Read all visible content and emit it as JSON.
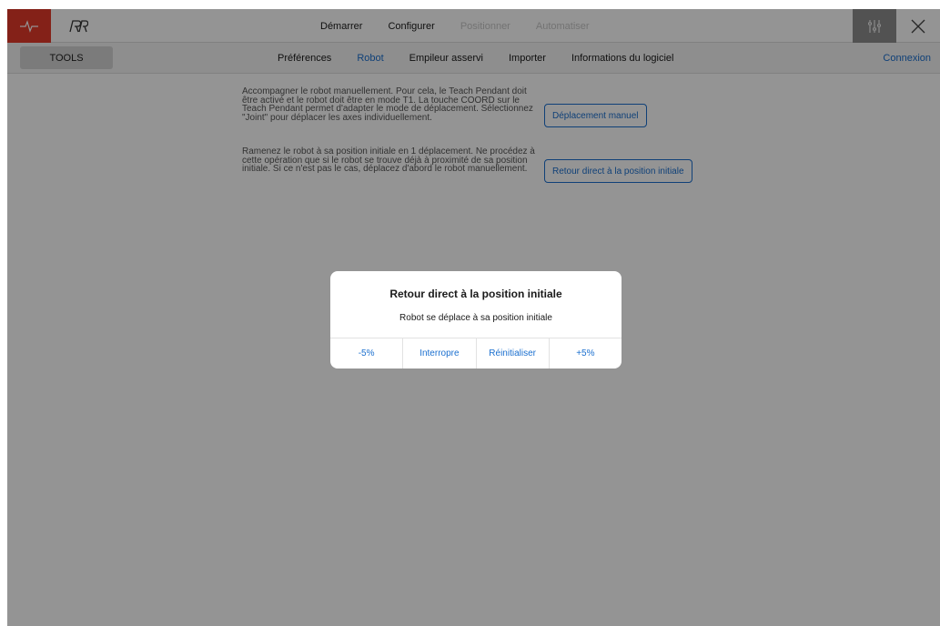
{
  "colors": {
    "accent": "#1a6fcf",
    "brand_red": "#e3392a",
    "overlay": "rgba(0,0,0,0.42)"
  },
  "topbar": {
    "pulse_icon": "pulse-icon",
    "logo_icon": "robot-logo-icon",
    "nav": [
      "Démarrer",
      "Configurer",
      "Positionner",
      "Automatiser"
    ],
    "disabled": [
      "Positionner",
      "Automatiser"
    ],
    "settings_icon": "sliders-icon",
    "close_icon": "close-icon"
  },
  "subbar": {
    "tools_label": "TOOLS",
    "tabs": [
      "Préférences",
      "Robot",
      "Empileur asservi",
      "Importer",
      "Informations du logiciel"
    ],
    "active_tab": "Robot",
    "login_label": "Connexion"
  },
  "content": {
    "manual": {
      "text": "Accompagner le robot manuellement. Pour cela, le Teach Pendant doit être activé et le robot doit être en mode T1. La touche COORD sur le Teach Pendant permet d'adapter le mode de déplacement. Sélectionnez \"Joint\" pour déplacer les axes individuellement.",
      "button": "Déplacement manuel"
    },
    "home": {
      "text": "Ramenez le robot à sa position initiale en 1 déplacement. Ne procédez à cette opération que si le robot se trouve déjà à proximité de sa position initiale. Si ce n'est pas le cas, déplacez d'abord le robot manuellement.",
      "button": "Retour direct à la position initiale"
    }
  },
  "dialog": {
    "title": "Retour direct à la position initiale",
    "message": "Robot se déplace à sa position initiale",
    "actions": [
      "-5%",
      "Interropre",
      "Réinitialiser",
      "+5%"
    ]
  }
}
